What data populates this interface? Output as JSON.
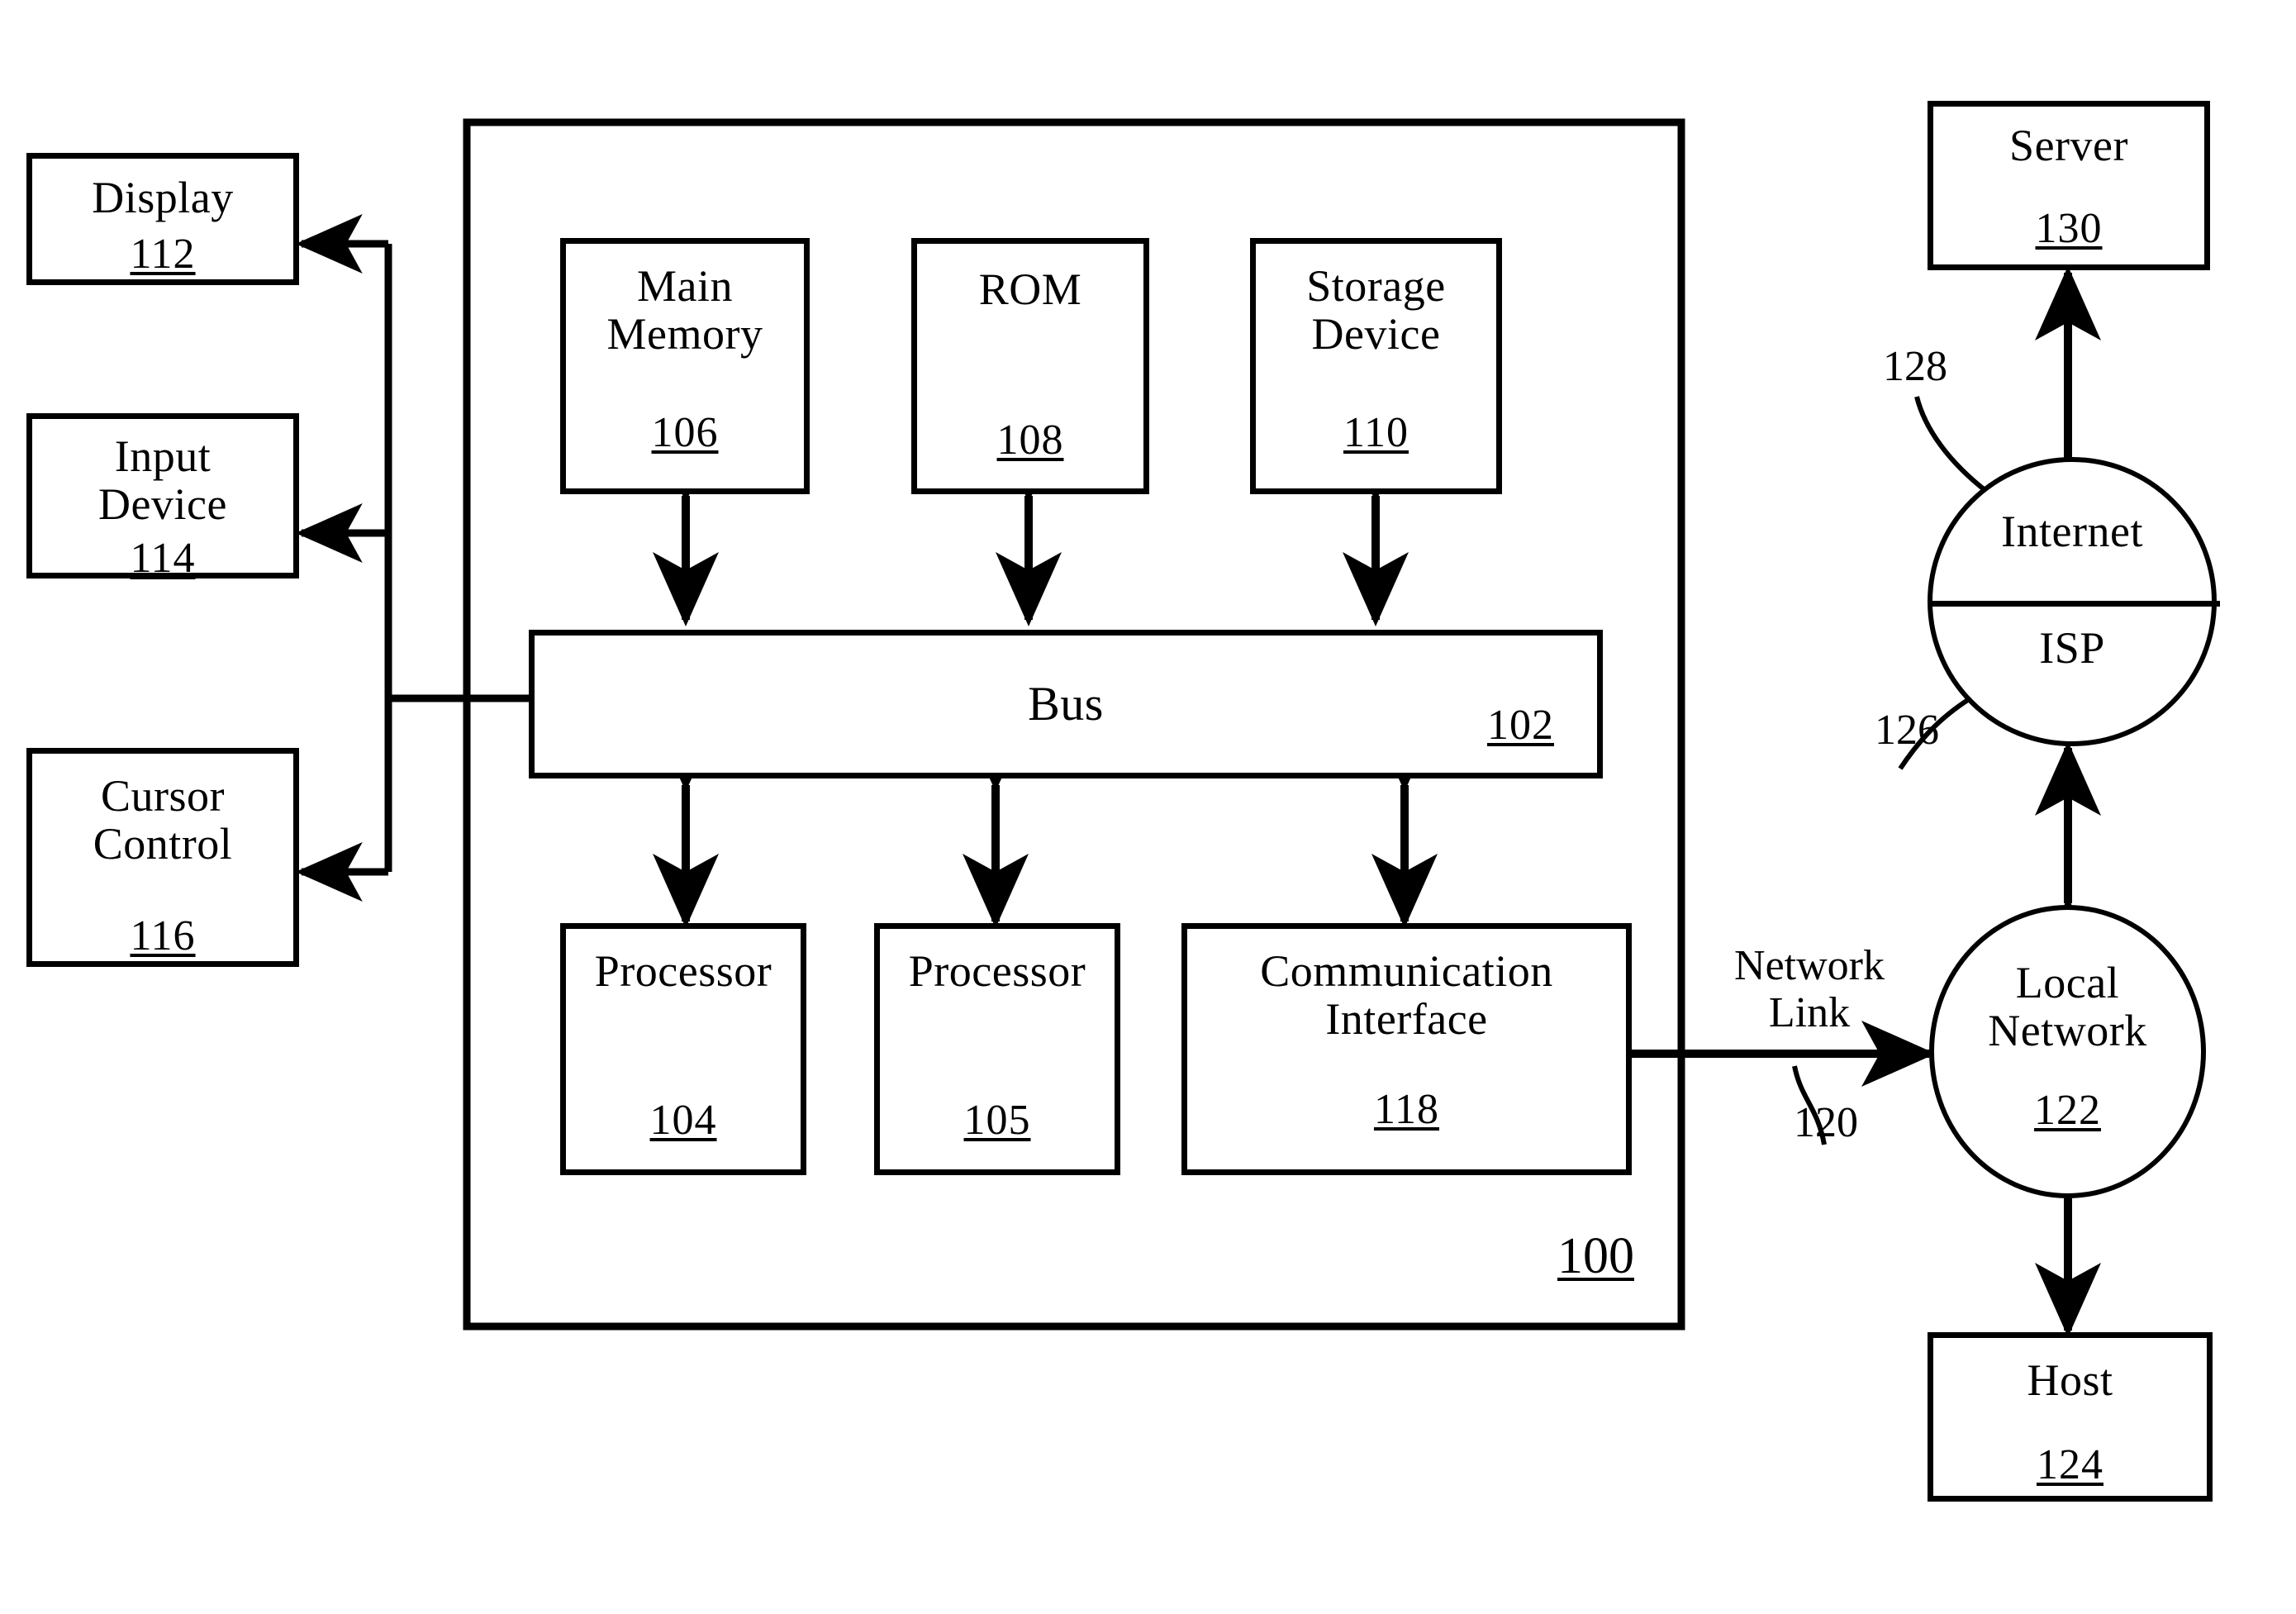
{
  "figure": {
    "type": "patent-block-diagram",
    "system_ref": "100"
  },
  "peripherals": [
    {
      "name": "display",
      "label": "Display",
      "ref": "112"
    },
    {
      "name": "input-device",
      "label": "Input\nDevice",
      "ref": "114"
    },
    {
      "name": "cursor-control",
      "label": "Cursor\nControl",
      "ref": "116"
    }
  ],
  "internal_top": [
    {
      "name": "main-memory",
      "label": "Main\nMemory",
      "ref": "106"
    },
    {
      "name": "rom",
      "label": "ROM",
      "ref": "108"
    },
    {
      "name": "storage-device",
      "label": "Storage\nDevice",
      "ref": "110"
    }
  ],
  "bus": {
    "label": "Bus",
    "ref": "102"
  },
  "internal_bottom": [
    {
      "name": "processor-104",
      "label": "Processor",
      "ref": "104"
    },
    {
      "name": "processor-105",
      "label": "Processor",
      "ref": "105"
    },
    {
      "name": "communication-interface",
      "label": "Communication\nInterface",
      "ref": "118"
    }
  ],
  "network": {
    "network_link_label": "Network\nLink",
    "network_link_ref": "120",
    "local_network": {
      "label": "Local\nNetwork",
      "ref": "122"
    },
    "host": {
      "label": "Host",
      "ref": "124"
    },
    "cloud": {
      "top_label": "Internet",
      "bottom_label": "ISP",
      "internet_ref": "128",
      "isp_ref": "126"
    },
    "server": {
      "label": "Server",
      "ref": "130"
    }
  },
  "colors": {
    "stroke": "#000000",
    "background": "#ffffff"
  }
}
